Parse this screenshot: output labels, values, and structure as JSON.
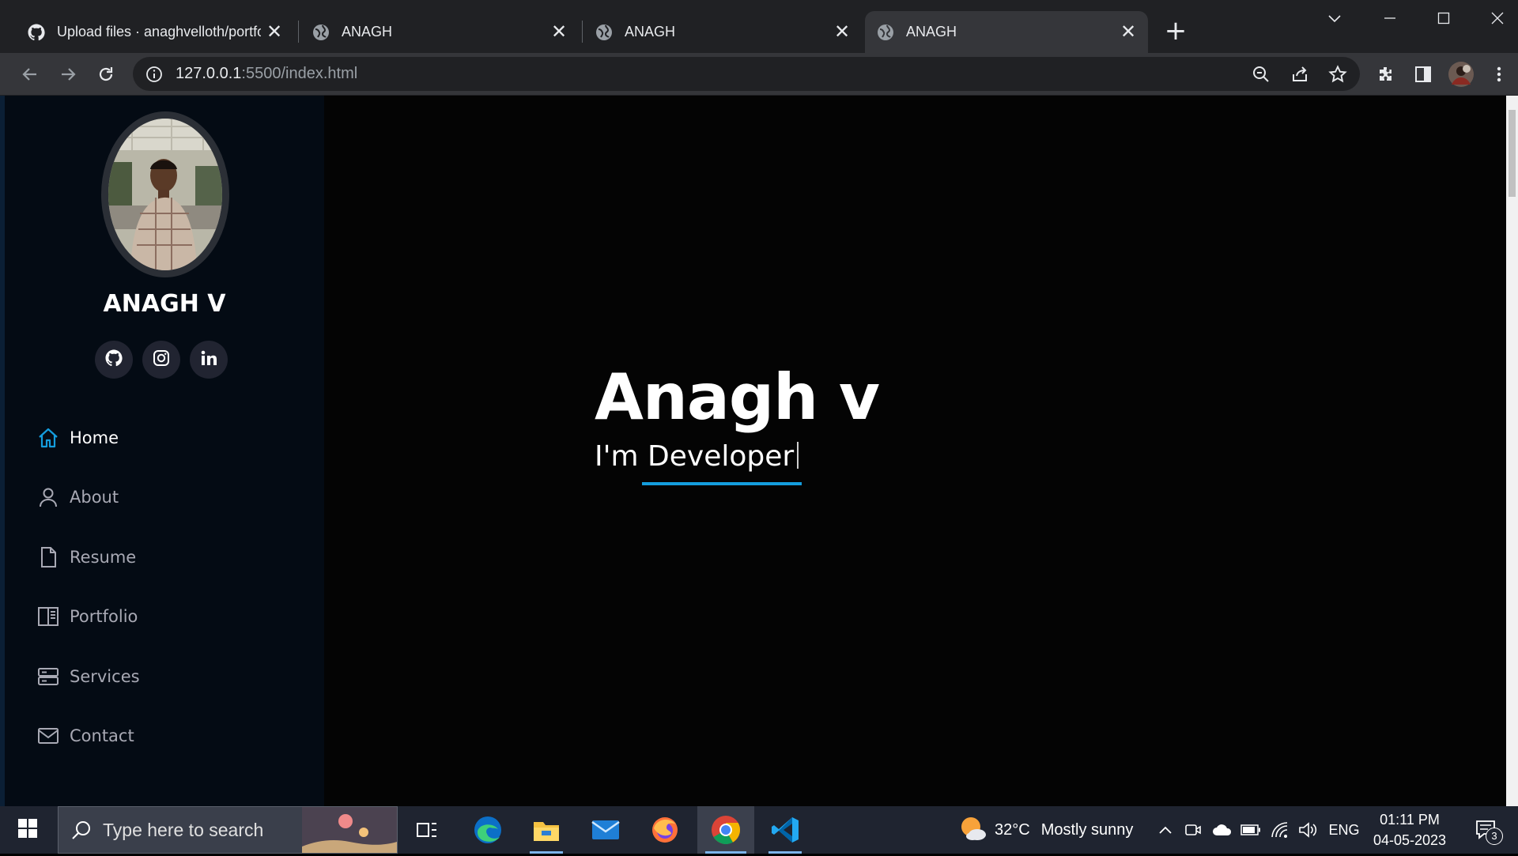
{
  "browser": {
    "tabs": [
      {
        "title": "Upload files · anaghvelloth/portfo",
        "favicon": "github-icon",
        "active": false
      },
      {
        "title": "ANAGH",
        "favicon": "globe-icon",
        "active": false
      },
      {
        "title": "ANAGH",
        "favicon": "globe-icon",
        "active": false
      },
      {
        "title": "ANAGH",
        "favicon": "globe-icon",
        "active": true
      }
    ],
    "url_host": "127.0.0.1",
    "url_rest": ":5500/index.html"
  },
  "sidebar": {
    "name": "ANAGH V",
    "social": [
      "github-icon",
      "instagram-icon",
      "linkedin-icon"
    ],
    "nav": [
      {
        "label": "Home",
        "icon": "home-icon",
        "active": true
      },
      {
        "label": "About",
        "icon": "person-icon",
        "active": false
      },
      {
        "label": "Resume",
        "icon": "file-icon",
        "active": false
      },
      {
        "label": "Portfolio",
        "icon": "book-icon",
        "active": false
      },
      {
        "label": "Services",
        "icon": "server-icon",
        "active": false
      },
      {
        "label": "Contact",
        "icon": "envelope-icon",
        "active": false
      }
    ]
  },
  "hero": {
    "title": "Anagh v",
    "subtitle": "I'm Developer",
    "accent": "#149ddd"
  },
  "taskbar": {
    "search_placeholder": "Type here to search",
    "weather_temp": "32°C",
    "weather_desc": "Mostly sunny",
    "language": "ENG",
    "time": "01:11 PM",
    "date": "04-05-2023",
    "notification_count": "3"
  }
}
